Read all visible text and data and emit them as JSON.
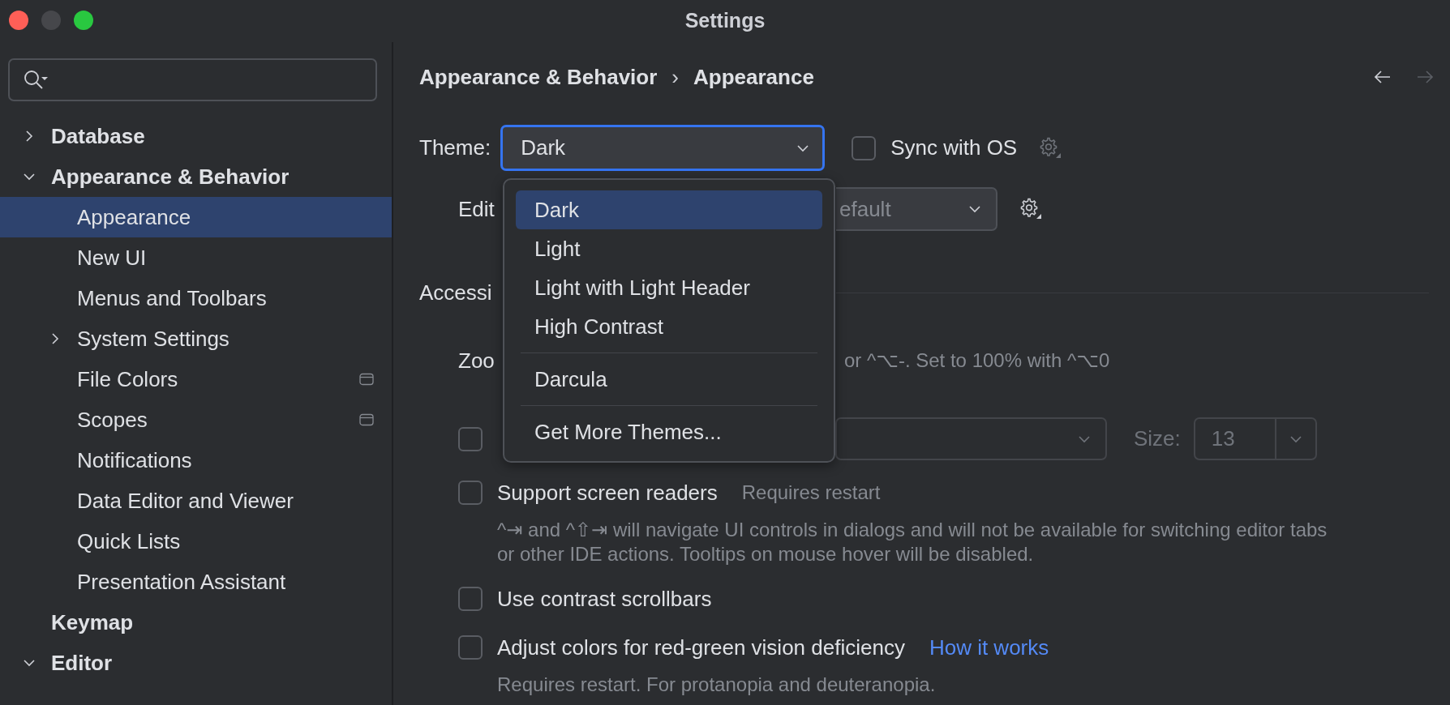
{
  "window": {
    "title": "Settings"
  },
  "sidebar": {
    "tree": [
      {
        "label": "Database",
        "kind": "group",
        "expanded": false,
        "selected": false,
        "trailing_icon": false
      },
      {
        "label": "Appearance & Behavior",
        "kind": "group",
        "expanded": true,
        "selected": false,
        "trailing_icon": false,
        "children": [
          {
            "label": "Appearance",
            "kind": "leaf",
            "selected": true,
            "trailing_icon": false
          },
          {
            "label": "New UI",
            "kind": "leaf",
            "selected": false,
            "trailing_icon": false
          },
          {
            "label": "Menus and Toolbars",
            "kind": "leaf",
            "selected": false,
            "trailing_icon": false
          },
          {
            "label": "System Settings",
            "kind": "group",
            "expanded": false,
            "selected": false,
            "trailing_icon": false
          },
          {
            "label": "File Colors",
            "kind": "leaf",
            "selected": false,
            "trailing_icon": true
          },
          {
            "label": "Scopes",
            "kind": "leaf",
            "selected": false,
            "trailing_icon": true
          },
          {
            "label": "Notifications",
            "kind": "leaf",
            "selected": false,
            "trailing_icon": false
          },
          {
            "label": "Data Editor and Viewer",
            "kind": "leaf",
            "selected": false,
            "trailing_icon": false
          },
          {
            "label": "Quick Lists",
            "kind": "leaf",
            "selected": false,
            "trailing_icon": false
          },
          {
            "label": "Presentation Assistant",
            "kind": "leaf",
            "selected": false,
            "trailing_icon": false
          }
        ]
      },
      {
        "label": "Keymap",
        "kind": "leaf",
        "selected": false,
        "trailing_icon": false
      },
      {
        "label": "Editor",
        "kind": "group",
        "expanded": true,
        "selected": false,
        "trailing_icon": false
      }
    ]
  },
  "content": {
    "breadcrumb": {
      "parts": [
        "Appearance & Behavior",
        "Appearance"
      ],
      "separator": "›"
    },
    "navigation": {
      "back_disabled": false,
      "forward_disabled": true
    },
    "theme": {
      "label": "Theme:",
      "value": "Dark",
      "focused": true
    },
    "sync_with_os": {
      "label": "Sync with OS",
      "checked": false,
      "settings_disabled": true
    },
    "editor_scheme": {
      "label": "Edit",
      "value": "efault"
    },
    "theme_menu": {
      "groups": [
        {
          "items": [
            {
              "label": "Dark",
              "selected": true
            },
            {
              "label": "Light",
              "selected": false
            },
            {
              "label": "Light with Light Header",
              "selected": false
            },
            {
              "label": "High Contrast",
              "selected": false
            }
          ]
        },
        {
          "items": [
            {
              "label": "Darcula",
              "selected": false
            }
          ]
        },
        {
          "items": [
            {
              "label": "Get More Themes...",
              "selected": false
            }
          ]
        }
      ]
    },
    "accessibility": {
      "title": "Accessi",
      "zoom_label": "Zoo",
      "zoom_hint": "or ^⌥-. Set to 100% with ^⌥0",
      "font": {
        "checked": false,
        "disabled": true,
        "size_label": "Size:",
        "size": "13"
      },
      "options": [
        {
          "label": "Support screen readers",
          "checked": false,
          "note": "Requires restart",
          "description": "^⇥ and ^⇧⇥ will navigate UI controls in dialogs and will not be available for switching editor tabs or other IDE actions. Tooltips on mouse hover will be disabled."
        },
        {
          "label": "Use contrast scrollbars",
          "checked": false
        },
        {
          "label": "Adjust colors for red-green vision deficiency",
          "checked": false,
          "link": "How it works",
          "description": "Requires restart. For protanopia and deuteranopia."
        }
      ]
    }
  }
}
